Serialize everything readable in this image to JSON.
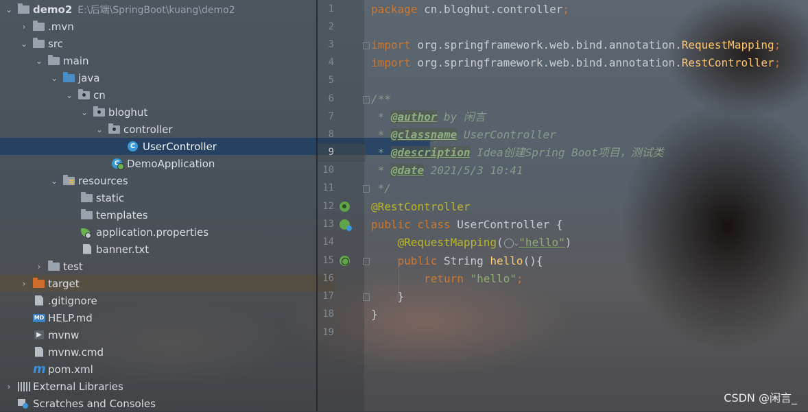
{
  "project_tree": {
    "items": [
      {
        "label": "demo2",
        "path": "E:\\后端\\SpringBoot\\kuang\\demo2"
      },
      {
        "label": ".mvn"
      },
      {
        "label": "src"
      },
      {
        "label": "main"
      },
      {
        "label": "java"
      },
      {
        "label": "cn"
      },
      {
        "label": "bloghut"
      },
      {
        "label": "controller"
      },
      {
        "label": "UserController",
        "icon_text": "C"
      },
      {
        "label": "DemoApplication",
        "icon_text": "C"
      },
      {
        "label": "resources"
      },
      {
        "label": "static"
      },
      {
        "label": "templates"
      },
      {
        "label": "application.properties"
      },
      {
        "label": "banner.txt"
      },
      {
        "label": "test"
      },
      {
        "label": "target"
      },
      {
        "label": ".gitignore"
      },
      {
        "label": "HELP.md",
        "icon_text": "MD"
      },
      {
        "label": "mvnw",
        "icon_text": "▶"
      },
      {
        "label": "mvnw.cmd"
      },
      {
        "label": "pom.xml",
        "icon_text": "m"
      },
      {
        "label": "External Libraries"
      },
      {
        "label": "Scratches and Consoles"
      }
    ]
  },
  "editor": {
    "line_numbers": [
      "1",
      "2",
      "3",
      "4",
      "5",
      "6",
      "7",
      "8",
      "9",
      "10",
      "11",
      "12",
      "13",
      "14",
      "15",
      "16",
      "17",
      "18",
      "19"
    ],
    "current_line": "9",
    "lines": {
      "l1": {
        "kw": "package",
        "rest": " cn.bloghut.controller",
        "end": ";"
      },
      "l3": {
        "kw": "import",
        "pkg": " org.springframework.web.bind.annotation.",
        "cls": "RequestMapping",
        "end": ";"
      },
      "l4": {
        "kw": "import",
        "pkg": " org.springframework.web.bind.annotation.",
        "cls": "RestController",
        "end": ";"
      },
      "l6": {
        "text": "/**"
      },
      "l7": {
        "star": " * ",
        "tag": "@author",
        "rest": " by 闲言"
      },
      "l8": {
        "star": " * ",
        "tag": "@classname",
        "rest": " UserController"
      },
      "l9": {
        "star": " * ",
        "tag": "@description",
        "rest": " Idea创建Spring Boot项目，测试类"
      },
      "l10": {
        "star": " * ",
        "tag": "@date",
        "rest": " 2021/5/3 10:41"
      },
      "l11": {
        "text": " */"
      },
      "l12": {
        "ann": "@RestController"
      },
      "l13": {
        "kw": "public class",
        "rest": " UserController {"
      },
      "l14": {
        "indent": "    ",
        "ann": "@RequestMapping",
        "open": "(",
        "str": "\"hello\"",
        "close": ")"
      },
      "l15": {
        "indent": "    ",
        "kw": "public",
        "rest": " String ",
        "fn": "hello",
        "tail": "(){"
      },
      "l16": {
        "indent": "        ",
        "kw": "return",
        "str": " \"hello\"",
        "end": ";"
      },
      "l17": {
        "text": "    }"
      },
      "l18": {
        "text": "}"
      }
    },
    "colors": {
      "keyword": "#cc7832",
      "annotation": "#bbb529",
      "comment": "#8a9a8a",
      "string": "#8fae6f",
      "function": "#ffc66d"
    }
  },
  "watermark": "CSDN @闲言_"
}
